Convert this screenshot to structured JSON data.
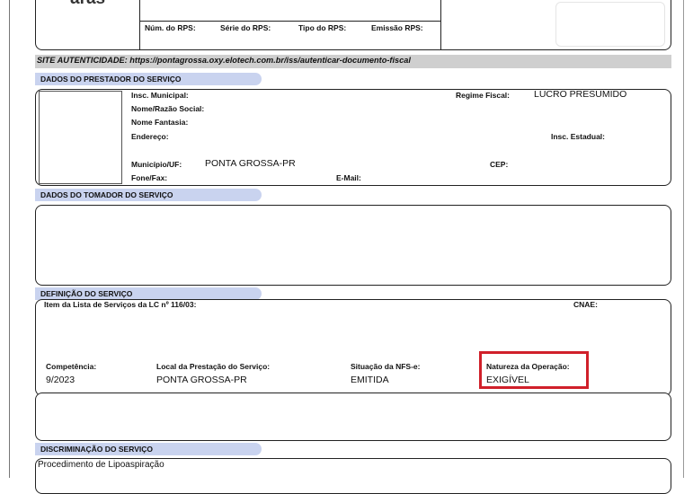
{
  "header": {
    "logo_text": "aras",
    "rps_labels": [
      "Núm. do RPS:",
      "Série do RPS:",
      "Tipo do RPS:",
      "Emissão RPS:"
    ]
  },
  "authenticity": {
    "text": "SITE AUTENTICIDADE: https://pontagrossa.oxy.elotech.com.br/iss/autenticar-documento-fiscal"
  },
  "prestador": {
    "section_title": "DADOS DO PRESTADOR DO SERVIÇO",
    "insc_municipal_label": "Insc. Municipal:",
    "nome_razao_label": "Nome/Razão Social:",
    "nome_fantasia_label": "Nome Fantasia:",
    "endereco_label": "Endereço:",
    "municipio_label": "Município/UF:",
    "municipio_value": "PONTA GROSSA-PR",
    "fone_label": "Fone/Fax:",
    "email_label": "E-Mail:",
    "regime_label": "Regime Fiscal:",
    "regime_value": "LUCRO PRESUMIDO",
    "insc_estadual_label": "Insc. Estadual:",
    "cep_label": "CEP:"
  },
  "tomador": {
    "section_title": "DADOS DO TOMADOR DO SERVIÇO"
  },
  "servico": {
    "section_title": "DEFINIÇÃO DO SERVIÇO",
    "item_lista_label": "Item da Lista de Serviços da LC nº 116/03:",
    "cnae_label": "CNAE:",
    "competencia_label": "Competência:",
    "competencia_value": "9/2023",
    "local_label": "Local da Prestação do Serviço:",
    "local_value": "PONTA GROSSA-PR",
    "situacao_label": "Situação da NFS-e:",
    "situacao_value": "EMITIDA",
    "natureza_label": "Natureza da Operação:",
    "natureza_value": "EXIGÍVEL",
    "highlight_color": "#d0202a"
  },
  "discriminacao": {
    "section_title": "DISCRIMINAÇÃO DO SERVIÇO",
    "text": "Procedimento de Lipoaspiração"
  }
}
